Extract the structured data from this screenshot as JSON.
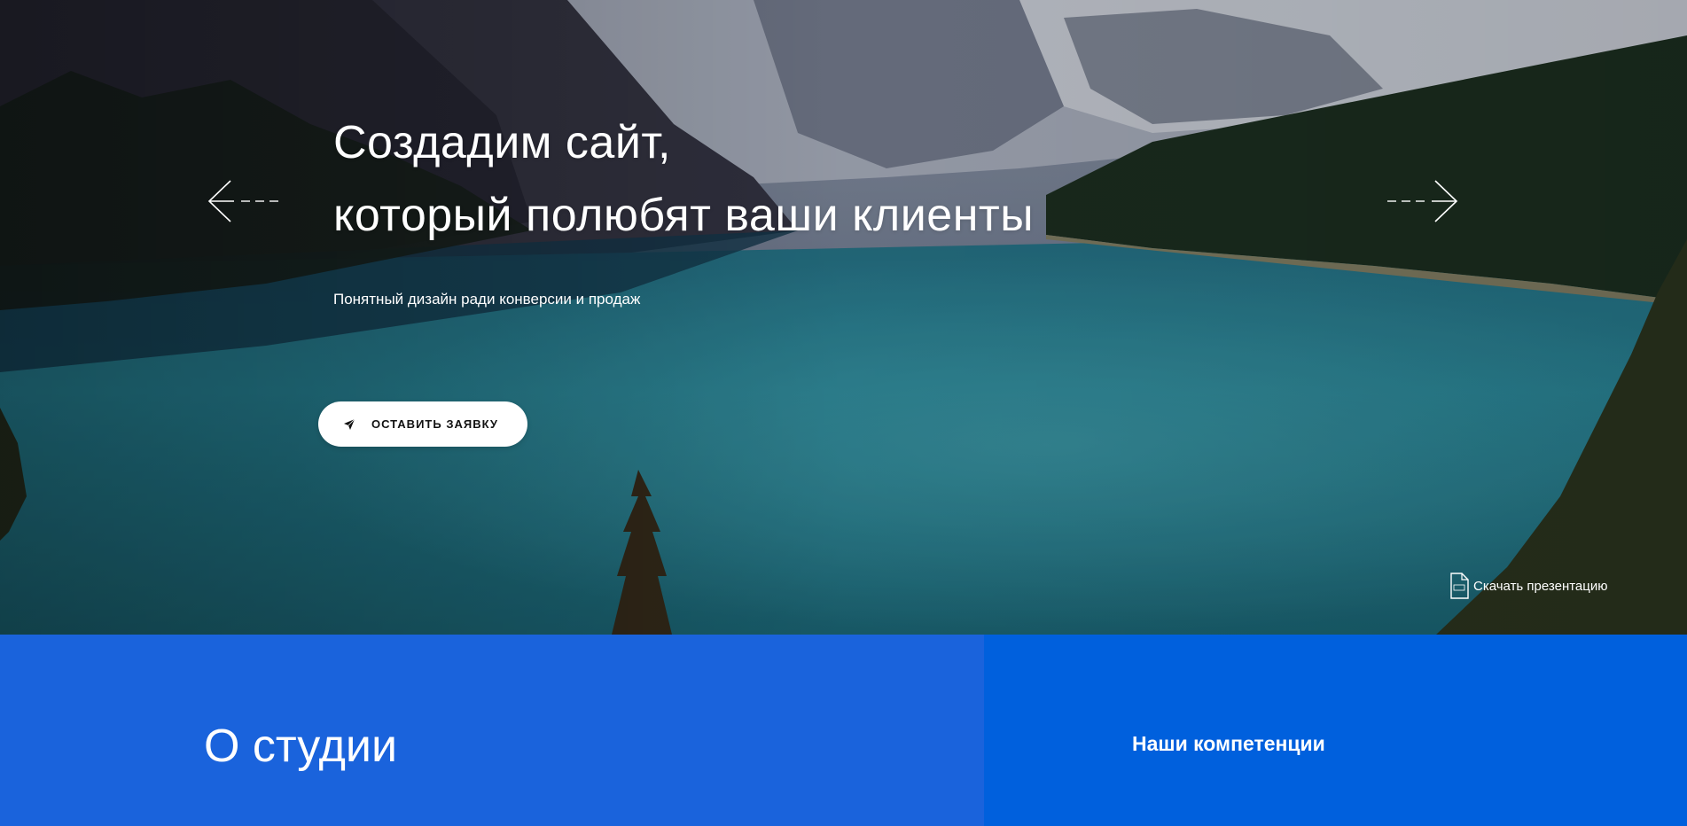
{
  "hero": {
    "headline_line1": "Создадим сайт,",
    "headline_line2": "который полюбят ваши клиенты",
    "subtitle": "Понятный дизайн ради конверсии и продаж",
    "cta_label": "ОСТАВИТЬ ЗАЯВКУ",
    "cta_icon": "paper-plane-icon",
    "prev_icon": "arrow-left-icon",
    "next_icon": "arrow-right-icon",
    "download_label": "Скачать презентацию",
    "download_icon": "pdf-file-icon"
  },
  "sections": {
    "about_title": "О студии",
    "competence_label": "Наши компетенции"
  },
  "colors": {
    "about_bg": "#1a63dc",
    "competence_bg": "#0060dd",
    "button_bg": "#ffffff",
    "text": "#ffffff"
  }
}
